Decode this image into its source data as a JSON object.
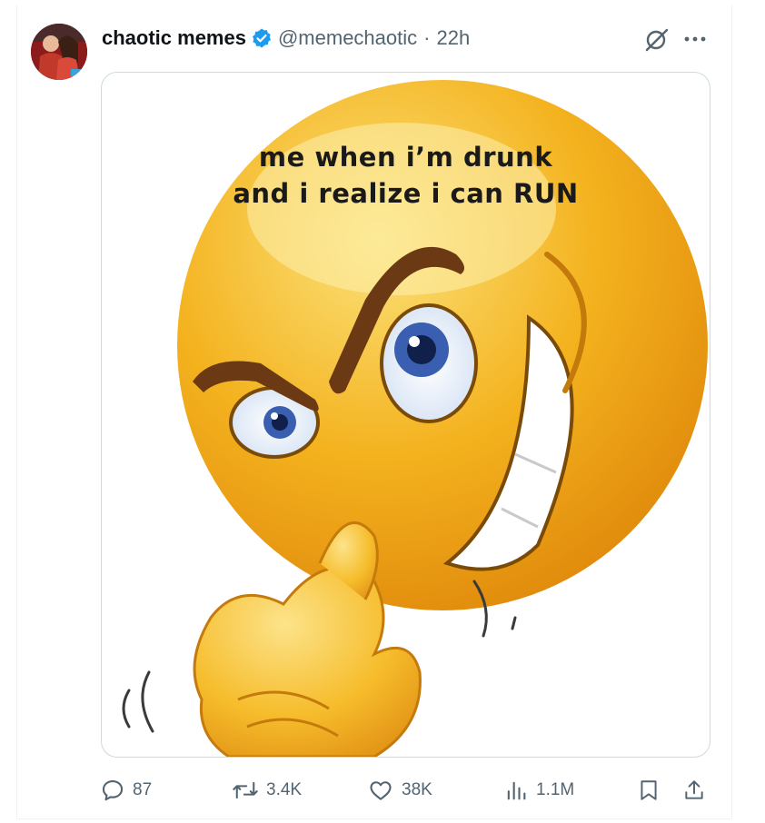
{
  "tweet": {
    "display_name": "chaotic memes",
    "handle": "@memechaotic",
    "separator": "·",
    "time": "22h",
    "verified_color": "#1d9bf0"
  },
  "media": {
    "caption_line1": "me when i’m drunk",
    "caption_line2": "and i realize i can RUN",
    "emoji_color": "#f4b21e"
  },
  "actions": {
    "replies": "87",
    "reposts": "3.4K",
    "likes": "38K",
    "views": "1.1M"
  },
  "icons": [
    "grok-icon",
    "more-icon",
    "reply-icon",
    "repost-icon",
    "like-icon",
    "views-icon",
    "bookmark-icon",
    "share-icon"
  ]
}
